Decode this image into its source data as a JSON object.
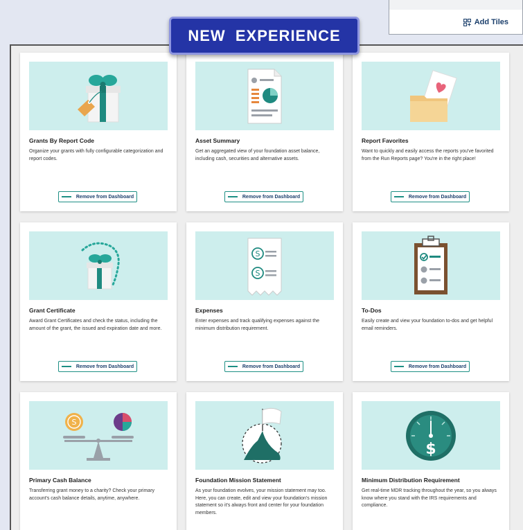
{
  "toolbar": {
    "add_tiles_label": "Add Tiles"
  },
  "banner": {
    "label": "NEW  EXPERIENCE"
  },
  "remove_label": "Remove from Dashboard",
  "tiles": [
    {
      "title": "Grants By Report Code",
      "description": "Organize your grants with fully configurable categorization and report codes.",
      "icon": "gift-icon"
    },
    {
      "title": "Asset Summary",
      "description": "Get an aggregated view of your foundation asset balance, including cash, securities and alternative assets.",
      "icon": "report-pie-icon"
    },
    {
      "title": "Report Favorites",
      "description": "Want to quickly and easily access the reports you've favorited from the Run Reports page? You're in the right place!",
      "icon": "folder-heart-icon"
    },
    {
      "title": "Grant Certificate",
      "description": "Award Grant Certificates and check the status, including the amount of the grant, the issued and expiration date and more.",
      "icon": "gift-certificate-icon"
    },
    {
      "title": "Expenses",
      "description": "Enter expenses and track qualifying expenses against the minimum distribution requirement.",
      "icon": "receipt-icon"
    },
    {
      "title": "To-Dos",
      "description": "Easily create and view your foundation to-dos and get helpful email reminders.",
      "icon": "clipboard-icon"
    },
    {
      "title": "Primary Cash Balance",
      "description": "Transferring grant money to a charity? Check your primary account's cash balance details, anytime, anywhere.",
      "icon": "scale-icon"
    },
    {
      "title": "Foundation Mission Statement",
      "description": "As your foundation evolves, your mission statement may too. Here, you can create, edit and view your foundation's mission statement so it's always front and center for your foundation members.",
      "icon": "mountain-flag-icon"
    },
    {
      "title": "Minimum Distribution Requirement",
      "description": "Get real-time MDR tracking throughout the year, so you always know where you stand with the IRS requirements and compliance.",
      "icon": "gauge-dollar-icon"
    }
  ]
}
